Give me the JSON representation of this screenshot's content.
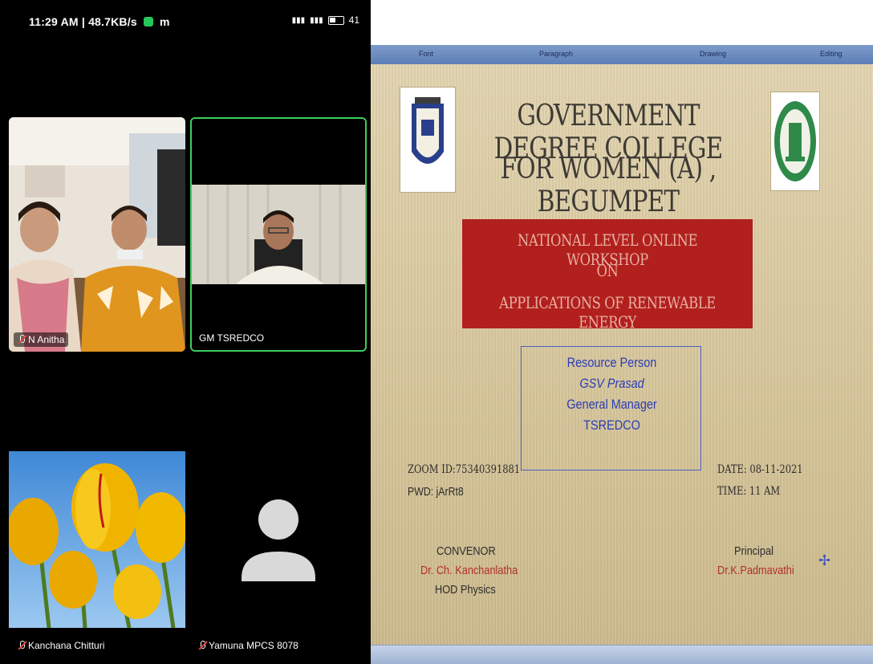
{
  "status_bar": {
    "time_speed": "11:29 AM | 48.7KB/s",
    "app_glyph": "m",
    "battery": "41"
  },
  "participants": [
    {
      "name": "N Anitha"
    },
    {
      "name": "GM TSREDCO"
    },
    {
      "name": "Kanchana Chitturi"
    },
    {
      "name": "Yamuna MPCS 8078"
    }
  ],
  "slide": {
    "menu": [
      "Font",
      "Paragraph",
      "Drawing",
      "Editing"
    ],
    "title_line1": "GOVERNMENT DEGREE COLLEGE",
    "title_line2": "FOR WOMEN (A) , BEGUMPET",
    "banner_line1": "NATIONAL LEVEL ONLINE WORKSHOP",
    "banner_line2": "ON",
    "banner_line3": "APPLICATIONS OF RENEWABLE ENERGY",
    "resource_label": "Resource Person",
    "resource_name": "GSV Prasad",
    "resource_role": "General Manager",
    "resource_org": "TSREDCO",
    "zoom_id": "ZOOM ID:75340391881",
    "pwd": "PWD: jArRt8",
    "date": "DATE: 08-11-2021",
    "time": "TIME: 11 AM",
    "convenor_title": "CONVENOR",
    "convenor_name": "Dr. Ch. Kanchanlatha",
    "convenor_dept": "HOD Physics",
    "principal_title": "Principal",
    "principal_name": "Dr.K.Padmavathi"
  },
  "colors": {
    "active_speaker_border": "#3ccf5c",
    "banner_red": "#b2201d",
    "resource_blue": "#2a3db5",
    "signature_red": "#b0302a"
  }
}
